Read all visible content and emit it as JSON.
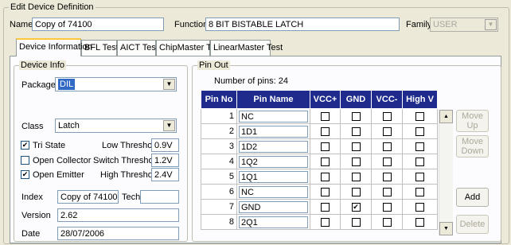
{
  "dialog": {
    "group_label": "Edit Device Definition"
  },
  "header": {
    "name_label": "Name",
    "name_value": "Copy of 74100",
    "function_label": "Function",
    "function_value": "8 BIT BISTABLE LATCH",
    "family_label": "Family",
    "family_value": "USER"
  },
  "tabs": [
    "Device Information",
    "BFL Test",
    "AICT Test",
    "ChipMaster Test",
    "LinearMaster Test"
  ],
  "device_info": {
    "group_label": "Device Info",
    "package_label": "Package",
    "package_value": "DIL",
    "class_label": "Class",
    "class_value": "Latch",
    "tri_state_label": "Tri State",
    "tri_state": true,
    "open_collector_label": "Open Collector",
    "open_collector": false,
    "open_emitter_label": "Open Emitter",
    "open_emitter": true,
    "low_threshold_label": "Low Threshold",
    "low_threshold": "0.9V",
    "switch_threshold_label": "Switch Threshold",
    "switch_threshold": "1.2V",
    "high_threshold_label": "High Threshold",
    "high_threshold": "2.4V",
    "index_label": "Index",
    "index_value": "Copy of 74100",
    "tech_label": "Tech",
    "tech_value": "",
    "version_label": "Version",
    "version_value": "2.62",
    "date_label": "Date",
    "date_value": "28/07/2006"
  },
  "pin_out": {
    "group_label": "Pin Out",
    "count_text": "Number of pins:  24",
    "columns": [
      "Pin No",
      "Pin Name",
      "VCC+",
      "GND",
      "VCC-",
      "High V"
    ],
    "rows": [
      {
        "no": "1",
        "name": "NC",
        "vccp": false,
        "gnd": false,
        "vccm": false,
        "highv": false
      },
      {
        "no": "2",
        "name": "1D1",
        "vccp": false,
        "gnd": false,
        "vccm": false,
        "highv": false
      },
      {
        "no": "3",
        "name": "1D2",
        "vccp": false,
        "gnd": false,
        "vccm": false,
        "highv": false
      },
      {
        "no": "4",
        "name": "1Q2",
        "vccp": false,
        "gnd": false,
        "vccm": false,
        "highv": false
      },
      {
        "no": "5",
        "name": "1Q1",
        "vccp": false,
        "gnd": false,
        "vccm": false,
        "highv": false
      },
      {
        "no": "6",
        "name": "NC",
        "vccp": false,
        "gnd": false,
        "vccm": false,
        "highv": false
      },
      {
        "no": "7",
        "name": "GND",
        "vccp": false,
        "gnd": true,
        "vccm": false,
        "highv": false
      },
      {
        "no": "8",
        "name": "2Q1",
        "vccp": false,
        "gnd": false,
        "vccm": false,
        "highv": false
      }
    ],
    "buttons": {
      "move_up": "Move Up",
      "move_down": "Move Down",
      "add": "Add",
      "delete": "Delete"
    }
  }
}
